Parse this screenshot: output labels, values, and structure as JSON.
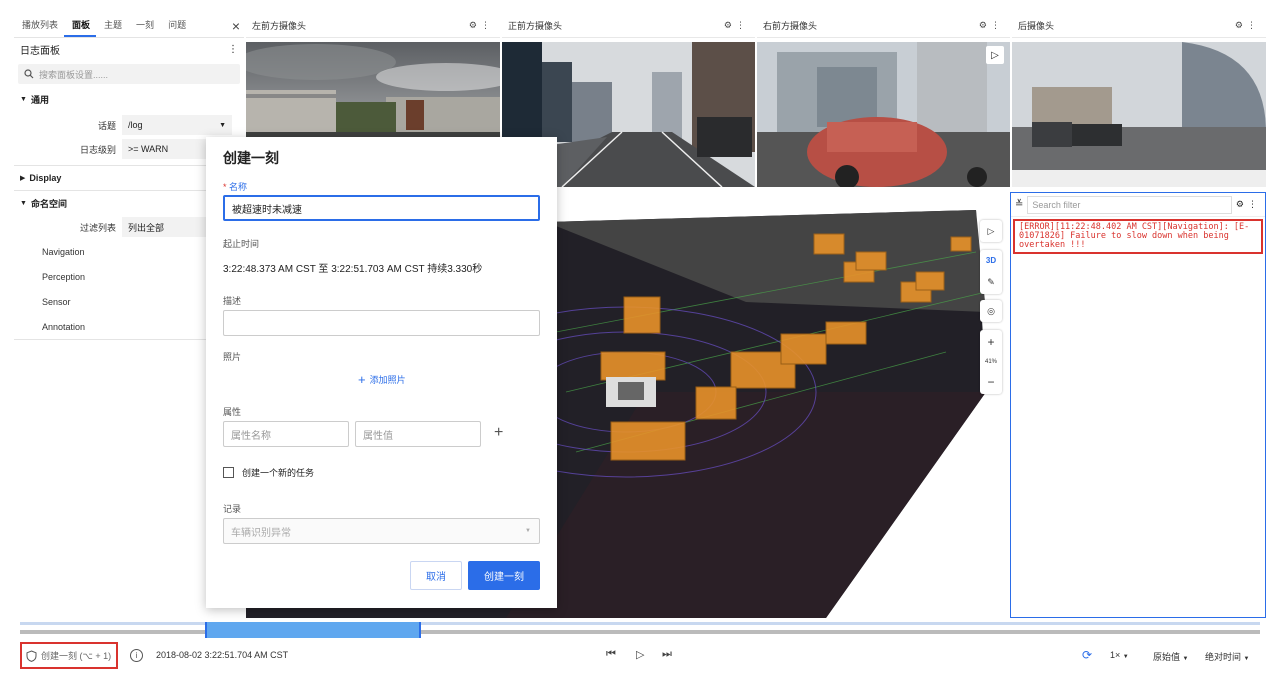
{
  "sidebar": {
    "tabs": [
      "播放列表",
      "面板",
      "主题",
      "一刻",
      "问题"
    ],
    "active_tab": "面板",
    "panel_title": "日志面板",
    "search_placeholder": "搜索面板设置......",
    "section_general": "通用",
    "topic_label": "话题",
    "topic_value": "/log",
    "level_label": "日志级别",
    "level_value": ">= WARN",
    "section_display": "Display",
    "section_namespace": "命名空间",
    "filter_label": "过滤列表",
    "filter_value": "列出全部",
    "namespaces": [
      "Navigation",
      "Perception",
      "Sensor",
      "Annotation"
    ]
  },
  "cameras": [
    {
      "title": "左前方摄像头"
    },
    {
      "title": "正前方摄像头"
    },
    {
      "title": "右前方摄像头"
    },
    {
      "title": "后摄像头"
    }
  ],
  "view3d": {
    "mode_label": "3D",
    "zoom_label": "41%"
  },
  "log_panel": {
    "filter_placeholder": "Search filter",
    "entries": [
      "[ERROR][11:22:48.402 AM CST][Navigation]: [E-01071826] Failure to slow down when being overtaken !!!"
    ]
  },
  "modal": {
    "title": "创建一刻",
    "name_label": "名称",
    "name_value": "被超速时未减速",
    "time_label": "起止时间",
    "time_value": "3:22:48.373 AM CST 至 3:22:51.703 AM CST 持续3.330秒",
    "desc_label": "描述",
    "photo_label": "照片",
    "add_photo": "添加照片",
    "attr_label": "属性",
    "attr_name_placeholder": "属性名称",
    "attr_value_placeholder": "属性值",
    "create_task_label": "创建一个新的任务",
    "record_label": "记录",
    "record_placeholder": "车辆识别异常",
    "cancel_label": "取消",
    "submit_label": "创建一刻"
  },
  "playback": {
    "create_moment": "创建一刻 (⌥ + 1)",
    "timestamp": "2018-08-02 3:22:51.704 AM CST",
    "speed": "1×",
    "value_mode": "原始值",
    "time_mode": "绝对时间"
  },
  "colors": {
    "accent": "#2b6de8",
    "error": "#d9332e",
    "box_orange": "#e8922a"
  }
}
